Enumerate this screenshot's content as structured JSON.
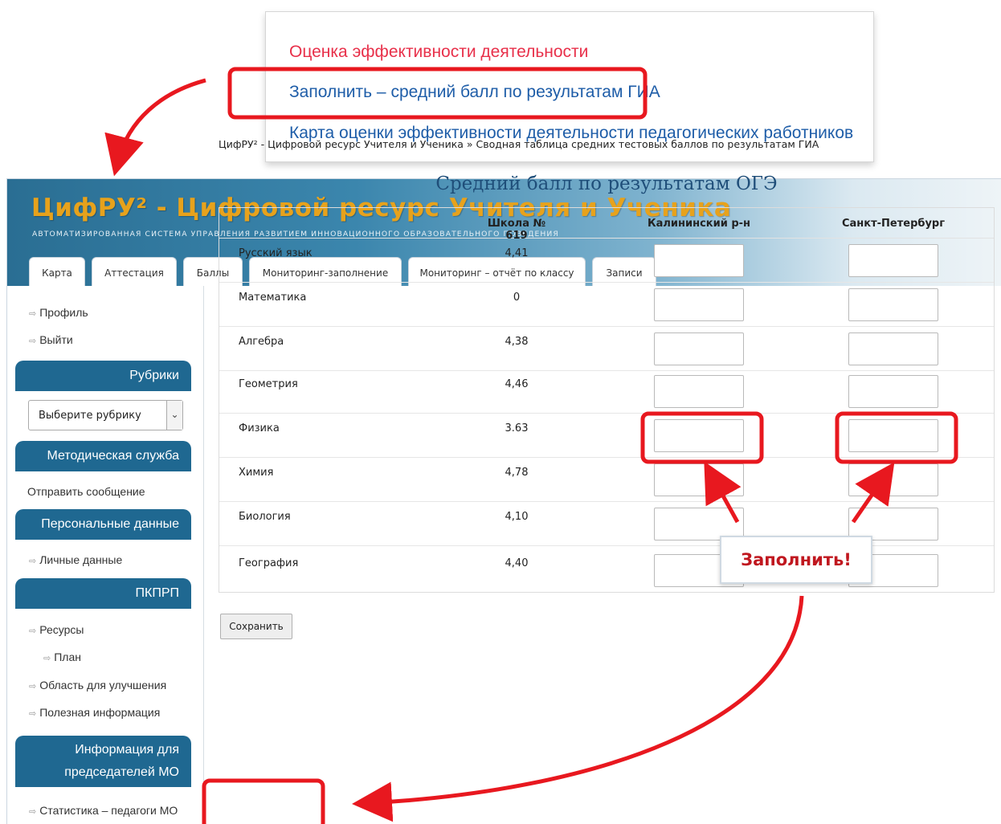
{
  "popup_menu": {
    "items": [
      "Оценка эффективности деятельности",
      "Заполнить – средний балл по результатам ГИА",
      "Карта оценки эффективности деятельности педагогических работников"
    ]
  },
  "header": {
    "logo_text": "ЦифРУ² - Цифровой ресурс Учителя и Ученика",
    "tagline": "АВТОМАТИЗИРОВАННАЯ СИСТЕМА УПРАВЛЕНИЯ РАЗВИТИЕМ ИННОВАЦИОННОГО ОБРАЗОВАТЕЛЬНОГО ПОВЕДЕНИЯ",
    "tabs": [
      "Карта",
      "Аттестация",
      "Баллы",
      "Мониторинг-заполнение",
      "Мониторинг – отчёт по классу",
      "Записи"
    ]
  },
  "sidebar": {
    "profile": "Профиль",
    "logout": "Выйти",
    "rubrics_head": "Рубрики",
    "rubric_select": "Выберите рубрику",
    "method_head": "Методическая служба",
    "send_message": "Отправить сообщение",
    "personal_head": "Персональные данные",
    "personal_data": "Личные данные",
    "pkprp_head": "ПКПРП",
    "resources": "Ресурсы",
    "plan": "План",
    "improvement": "Область для улучшения",
    "useful_info": "Полезная информация",
    "chairs_head_1": "Информация для",
    "chairs_head_2": "председателей МО",
    "stats": "Статистика – педагоги МО"
  },
  "main": {
    "breadcrumb": "ЦифРУ² - Цифровой ресурс Учителя и Ученика » Сводная таблица средних тестовых баллов по результатам ГИА",
    "title": "Средний балл по результатам ОГЭ",
    "columns": [
      "",
      "Школа № 619",
      "Калининский р-н",
      "Санкт-Петербург"
    ],
    "rows": [
      {
        "subject": "Русский язык",
        "school": "4,41"
      },
      {
        "subject": "Математика",
        "school": "0"
      },
      {
        "subject": "Алгебра",
        "school": "4,38"
      },
      {
        "subject": "Геометрия",
        "school": "4,46"
      },
      {
        "subject": "Физика",
        "school": "3.63"
      },
      {
        "subject": "Химия",
        "school": "4,78"
      },
      {
        "subject": "Биология",
        "school": "4,10"
      },
      {
        "subject": "География",
        "school": "4,40"
      }
    ],
    "save_button": "Сохранить"
  },
  "annotation": {
    "callout": "Заполнить!",
    "highlight_color": "#e8181f"
  }
}
